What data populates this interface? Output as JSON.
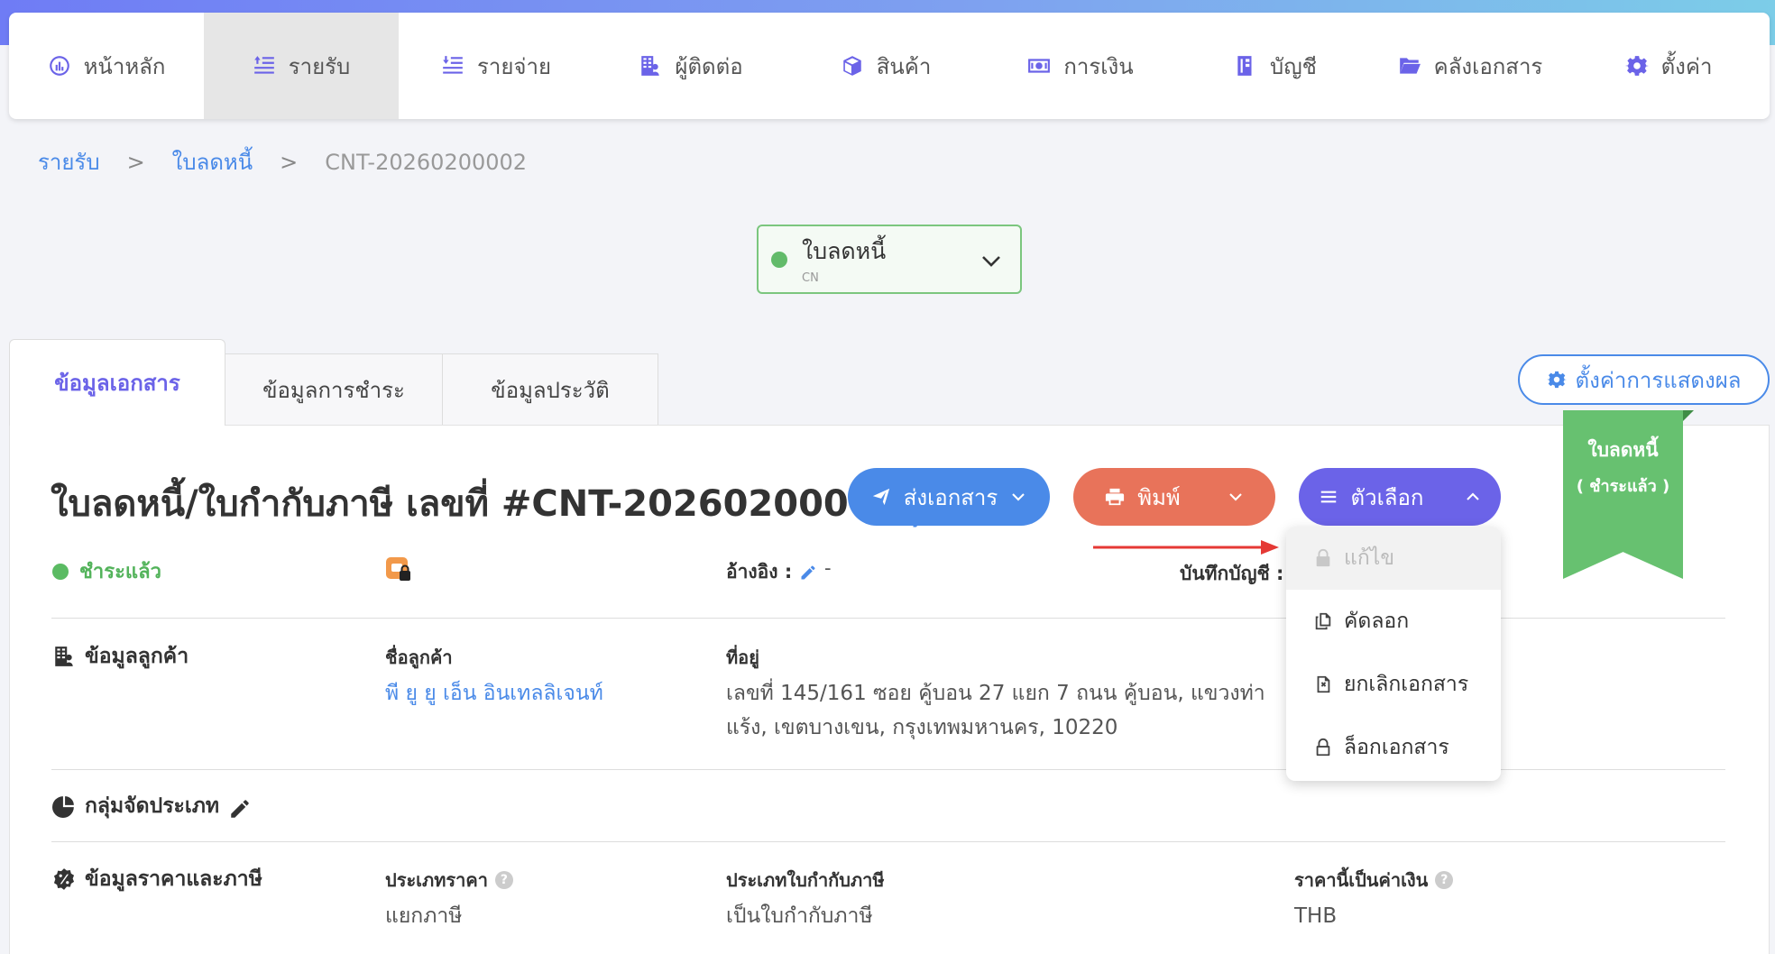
{
  "nav": {
    "items": [
      {
        "label": "หน้าหลัก",
        "icon": "dashboard-icon"
      },
      {
        "label": "รายรับ",
        "icon": "income-icon"
      },
      {
        "label": "รายจ่าย",
        "icon": "expense-icon"
      },
      {
        "label": "ผู้ติดต่อ",
        "icon": "contacts-icon"
      },
      {
        "label": "สินค้า",
        "icon": "box-icon"
      },
      {
        "label": "การเงิน",
        "icon": "money-icon"
      },
      {
        "label": "บัญชี",
        "icon": "ledger-icon"
      },
      {
        "label": "คลังเอกสาร",
        "icon": "folder-icon"
      },
      {
        "label": "ตั้งค่า",
        "icon": "gear-icon"
      }
    ],
    "active_index": 1
  },
  "breadcrumb": {
    "items": [
      "รายรับ",
      "ใบลดหนี้",
      "CNT-20260200002"
    ],
    "separator": ">"
  },
  "doc_type": {
    "label": "ใบลดหนี้",
    "code": "CN",
    "status_color": "#62bb6a"
  },
  "tabs": [
    "ข้อมูลเอกสาร",
    "ข้อมูลการชำระ",
    "ข้อมูลประวัติ"
  ],
  "display_settings_label": "ตั้งค่าการแสดงผล",
  "document": {
    "title": "ใบลดหนี้/ใบกำกับภาษี เลขที่ #CNT-20260200002",
    "status": "ชำระแล้ว",
    "reference_label": "อ้างอิง :",
    "reference_value": "-",
    "account_label": "บันทึกบัญชี :"
  },
  "actions": {
    "send": "ส่งเอกสาร",
    "print": "พิมพ์",
    "options": "ตัวเลือก"
  },
  "options_menu": [
    {
      "label": "แก้ไข",
      "disabled": true,
      "icon": "lock-icon"
    },
    {
      "label": "คัดลอก",
      "disabled": false,
      "icon": "copy-icon"
    },
    {
      "label": "ยกเลิกเอกสาร",
      "disabled": false,
      "icon": "cancel-document-icon"
    },
    {
      "label": "ล็อกเอกสาร",
      "disabled": false,
      "icon": "lock-outline-icon"
    }
  ],
  "ribbon": {
    "line1": "ใบลดหนี้",
    "line2": "( ชำระแล้ว )"
  },
  "customer": {
    "section_title": "ข้อมูลลูกค้า",
    "name_label": "ชื่อลูกค้า",
    "name_value": "พี ยู ยู เอ็น อินเทลลิเจนท์",
    "address_label": "ที่อยู่",
    "address_line1": "เลขที่ 145/161 ซอย คู้บอน 27 แยก 7 ถนน คู้บอน, แขวงท่า",
    "address_line2": "แร้ง, เขตบางเขน, กรุงเทพมหานคร, 10220"
  },
  "category": {
    "section_title": "กลุ่มจัดประเภท"
  },
  "pricing": {
    "section_title": "ข้อมูลราคาและภาษี",
    "price_type_label": "ประเภทราคา",
    "price_type_value": "แยกภาษี",
    "tax_invoice_label": "ประเภทใบกำกับภาษี",
    "tax_invoice_value": "เป็นใบกำกับภาษี",
    "currency_label": "ราคานี้เป็นค่าเงิน",
    "currency_value": "THB"
  },
  "colors": {
    "primary": "#6b63e8",
    "blue": "#4a8ae8",
    "orange": "#e8735a",
    "green": "#67c170"
  }
}
